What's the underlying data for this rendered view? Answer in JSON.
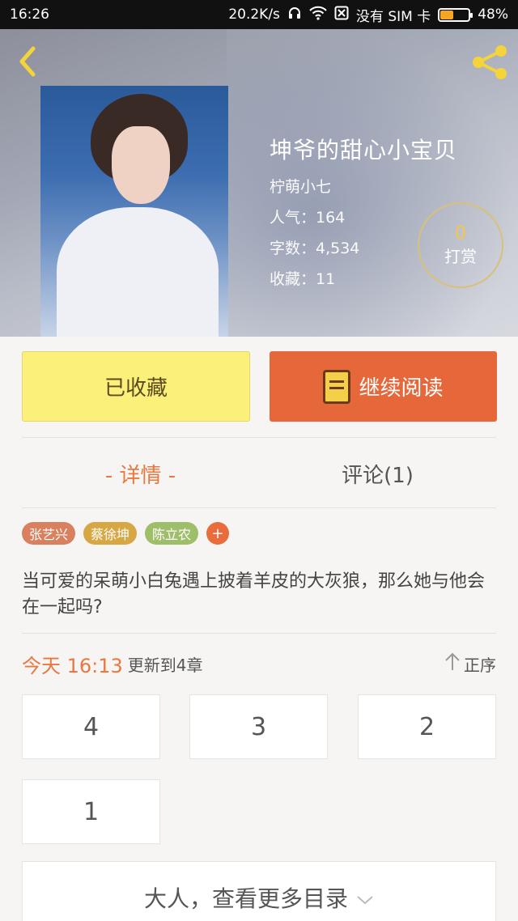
{
  "status_bar": {
    "time": "16:26",
    "speed": "20.2K/s",
    "sim_text": "没有 SIM 卡",
    "battery": "48%",
    "battery_level": 0.48
  },
  "book": {
    "title": "坤爷的甜心小宝贝",
    "author": "柠萌小七",
    "popularity": "人气：164",
    "word_count": "字数：4,534",
    "favorites": "收藏：11"
  },
  "tip": {
    "count": "0",
    "label": "打赏"
  },
  "actions": {
    "collected_label": "已收藏",
    "continue_label": "继续阅读"
  },
  "tabs": {
    "detail": "- 详情 -",
    "comments": "评论(1)"
  },
  "tags": [
    {
      "label": "张艺兴",
      "color": "#d9805f"
    },
    {
      "label": "蔡徐坤",
      "color": "#d6a742"
    },
    {
      "label": "陈立农",
      "color": "#9fbe6a"
    }
  ],
  "tag_add": "+",
  "synopsis": "当可爱的呆萌小白兔遇上披着羊皮的大灰狼，那么她与他会在一起吗?",
  "update": {
    "time": "今天 16:13",
    "text": "更新到4章",
    "sort_label": "正序"
  },
  "chapters": [
    "4",
    "3",
    "2",
    "1"
  ],
  "more_label": "大人，查看更多目录",
  "colors": {
    "accent": "#e8783f",
    "read_button": "#e6683a",
    "collected_button": "#fbf07a"
  }
}
